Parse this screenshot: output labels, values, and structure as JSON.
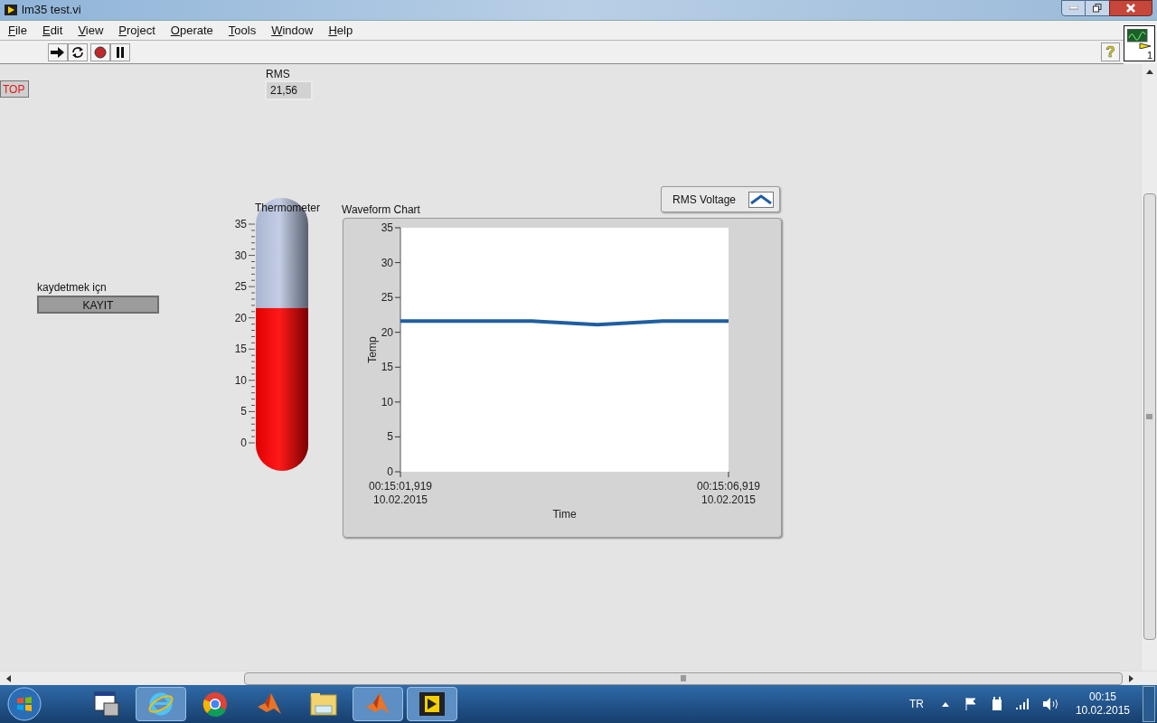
{
  "window": {
    "title": "lm35 test.vi"
  },
  "menu": [
    "File",
    "Edit",
    "View",
    "Project",
    "Operate",
    "Tools",
    "Window",
    "Help"
  ],
  "toolbar": {
    "help": "?"
  },
  "vi_icon": {
    "number": "1"
  },
  "panel": {
    "stop_button": {
      "label": "TOP"
    },
    "rms": {
      "label": "RMS",
      "value": "21,56"
    },
    "record": {
      "caption": "kaydetmek içn",
      "label": "KAYIT"
    },
    "thermometer": {
      "label": "Thermometer",
      "level": 0.616,
      "scale": [
        "35",
        "30",
        "25",
        "20",
        "15",
        "10",
        "5",
        "0"
      ]
    },
    "chart": {
      "title": "Waveform Chart",
      "chart_data": {
        "type": "line",
        "xlabel": "Time",
        "ylabel": "Temp",
        "categories": [
          "00:15:01,919\n10.02.2015",
          null,
          null,
          null,
          null,
          "00:15:06,919\n10.02.2015"
        ],
        "series": [
          {
            "name": "RMS Voltage",
            "color": "#1f5fa0",
            "values": [
              21.6,
              21.6,
              21.6,
              21.1,
              21.6,
              21.6
            ]
          }
        ],
        "ylim": [
          0,
          35
        ],
        "yticks": [
          0,
          5,
          10,
          15,
          20,
          25,
          30,
          35
        ]
      }
    }
  },
  "taskbar": {
    "language": "TR",
    "time": "00:15",
    "date": "10.02.2015"
  }
}
